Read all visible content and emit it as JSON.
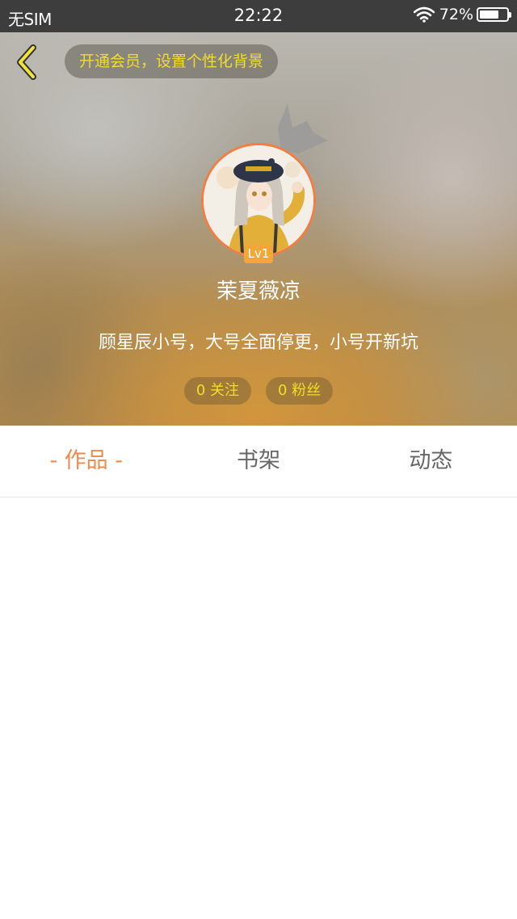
{
  "status_bar": {
    "carrier": "无SIM",
    "time": "22:22",
    "battery_percent": "72%",
    "battery_level": 0.72
  },
  "header": {
    "vip_prompt": "开通会员，设置个性化背景",
    "level": "Lv1",
    "username": "茉夏薇凉",
    "bio": "顾星辰小号，大号全面停更，小号开新坑",
    "following": "0 关注",
    "followers": "0 粉丝"
  },
  "tabs": [
    {
      "label": "- 作品 -",
      "active": true
    },
    {
      "label": "书架",
      "active": false
    },
    {
      "label": "动态",
      "active": false
    }
  ],
  "colors": {
    "accent": "#ef8a4b",
    "pill_text": "#f2dd2a",
    "level_badge": "#f3a73b"
  }
}
